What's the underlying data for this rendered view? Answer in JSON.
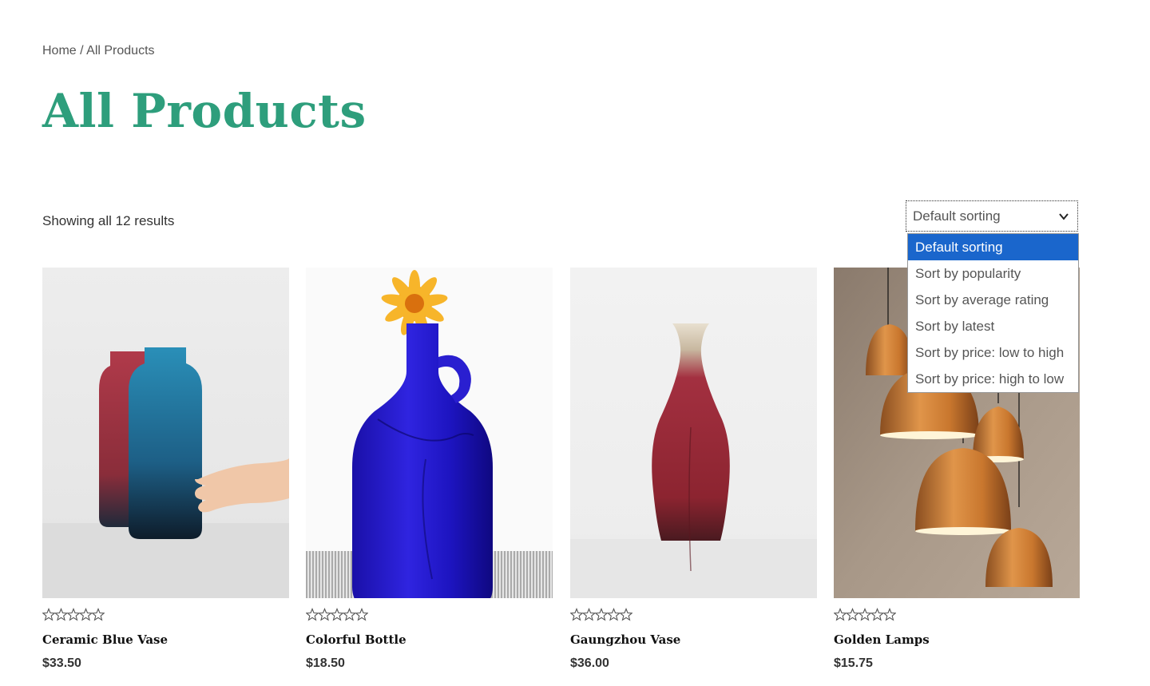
{
  "breadcrumb": {
    "home": "Home",
    "separator": " / ",
    "current": "All Products"
  },
  "page_title": "All Products",
  "result_count": "Showing all 12 results",
  "sort": {
    "selected": "Default sorting",
    "options": [
      "Default sorting",
      "Sort by popularity",
      "Sort by average rating",
      "Sort by latest",
      "Sort by price: low to high",
      "Sort by price: high to low"
    ]
  },
  "products": [
    {
      "name": "Ceramic Blue Vase",
      "price": "$33.50",
      "rating": 0
    },
    {
      "name": "Colorful Bottle",
      "price": "$18.50",
      "rating": 0
    },
    {
      "name": "Gaungzhou Vase",
      "price": "$36.00",
      "rating": 0
    },
    {
      "name": "Golden Lamps",
      "price": "$15.75",
      "rating": 0
    }
  ],
  "colors": {
    "title": "#2e9e7c",
    "dropdown_highlight": "#1a66cc"
  }
}
